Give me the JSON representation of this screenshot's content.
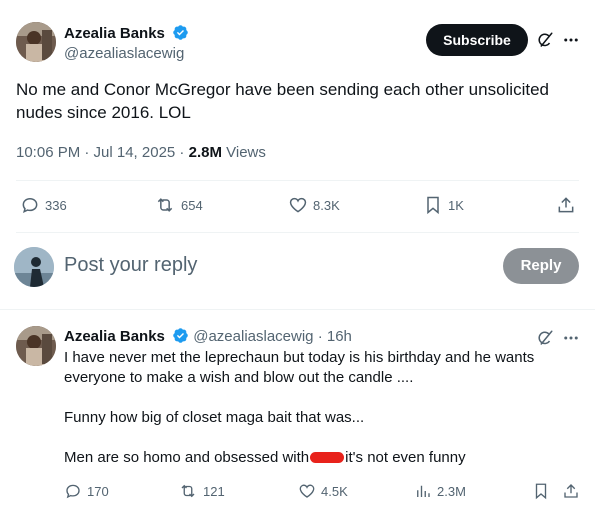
{
  "main_tweet": {
    "author_name": "Azealia Banks",
    "author_handle": "@azealiaslacewig",
    "subscribe_label": "Subscribe",
    "text": "No me and Conor McGregor have been sending each other unsolicited nudes since 2016. LOL",
    "time": "10:06 PM · Jul 14, 2025 · ",
    "views_count": "2.8M",
    "views_label": " Views",
    "replies": "336",
    "reposts": "654",
    "likes": "8.3K",
    "bookmarks": "1K"
  },
  "composer": {
    "placeholder": "Post your reply",
    "reply_label": "Reply"
  },
  "reply_tweet": {
    "author_name": "Azealia Banks",
    "author_handle": "@azealiaslacewig · 16h",
    "paragraph1": "I have never met the leprechaun but today is his birthday and he wants everyone to make a wish and blow out the candle ....",
    "paragraph2": "Funny how big of closet maga bait that was...",
    "paragraph3_start": "Men are so homo and obsessed with",
    "paragraph3_end": "it's not even funny",
    "replies": "170",
    "reposts": "121",
    "likes": "4.5K",
    "views": "2.3M"
  },
  "colors": {
    "verified": "#1d9bf0",
    "text_primary": "#0f1419",
    "text_secondary": "#536471",
    "redaction": "#e8221b"
  }
}
